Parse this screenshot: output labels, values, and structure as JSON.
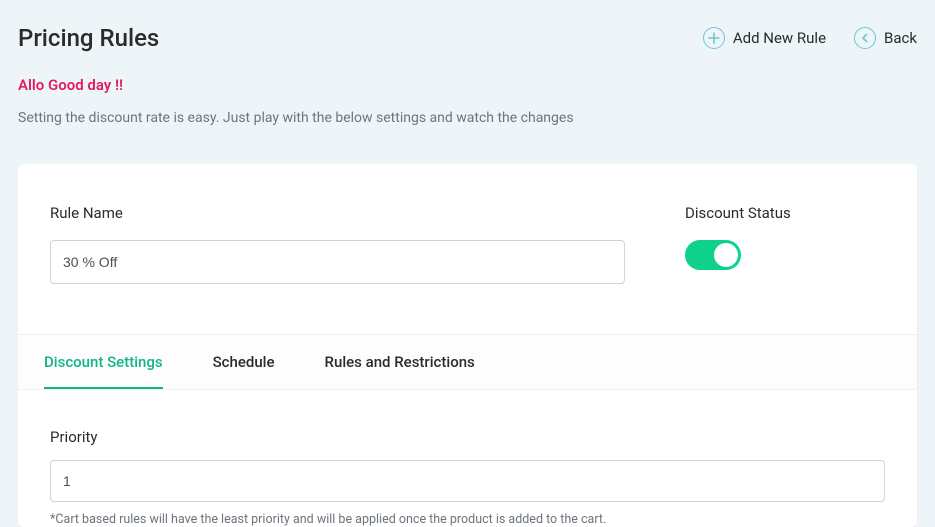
{
  "header": {
    "title": "Pricing Rules",
    "add_label": "Add New Rule",
    "back_label": "Back"
  },
  "greeting": "Allo Good day !!",
  "subtext": "Setting the discount rate is easy. Just play with the below settings and watch the changes",
  "form": {
    "rule_name_label": "Rule Name",
    "rule_name_value": "30 % Off",
    "discount_status_label": "Discount Status",
    "discount_status_on": true
  },
  "tabs": {
    "settings": "Discount Settings",
    "schedule": "Schedule",
    "rules": "Rules and Restrictions",
    "active": "settings"
  },
  "priority": {
    "label": "Priority",
    "value": "1",
    "note": "*Cart based rules will have the least priority and will be applied once the product is added to the cart."
  }
}
